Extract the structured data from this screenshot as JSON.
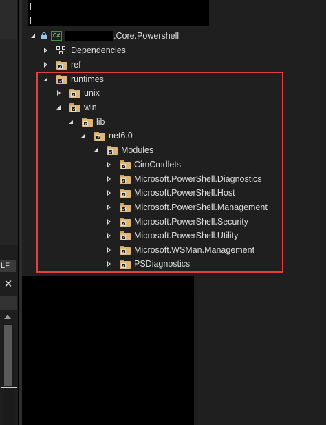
{
  "left_panel": {
    "lf_label": "LF",
    "close_glyph": "✕"
  },
  "project": {
    "name_suffix": ".Core.Powershell",
    "icon": "csharp-project-icon",
    "icon_text": "C#"
  },
  "tree": {
    "dependencies": "Dependencies",
    "ref": "ref",
    "runtimes": "runtimes",
    "unix": "unix",
    "win": "win",
    "lib": "lib",
    "net": "net6.0",
    "modules": "Modules",
    "module_items": [
      "CimCmdlets",
      "Microsoft.PowerShell.Diagnostics",
      "Microsoft.PowerShell.Host",
      "Microsoft.PowerShell.Management",
      "Microsoft.PowerShell.Security",
      "Microsoft.PowerShell.Utility",
      "Microsoft.WSMan.Management",
      "PSDiagnostics"
    ]
  },
  "colors": {
    "highlight": "#e04040",
    "folder": "#dcb67a",
    "background": "#1f1f1f"
  }
}
